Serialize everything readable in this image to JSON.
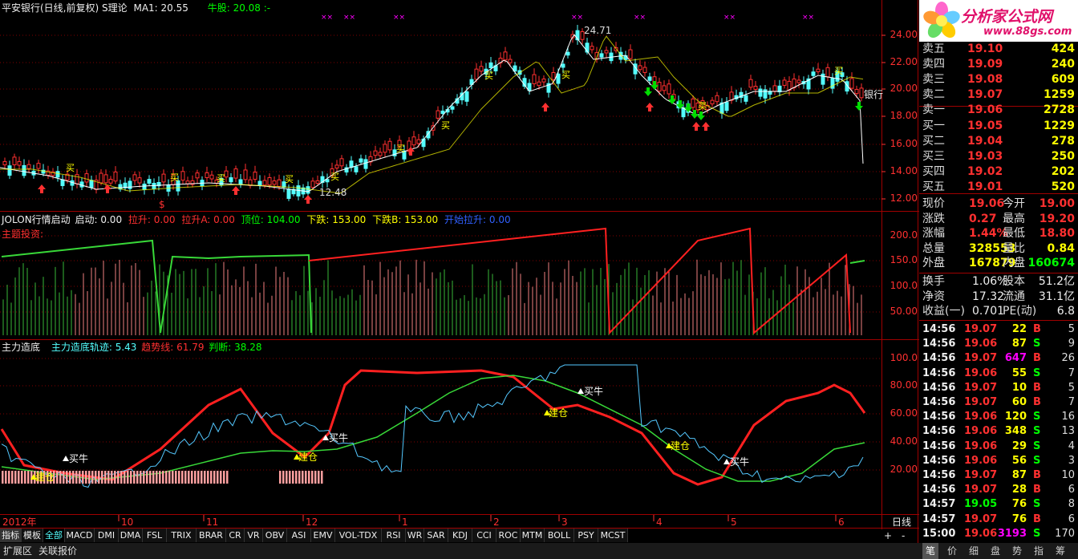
{
  "header": {
    "stock": "平安银行(日线,前复权)",
    "theory": "S理论",
    "ma": "MA1: 20.55",
    "bull": "牛股: 20.08",
    "dash": ":-"
  },
  "price_axis": [
    "24.00",
    "22.00",
    "20.00",
    "18.00",
    "16.00",
    "14.00",
    "12.00"
  ],
  "annotations": {
    "high": "24.71",
    "low": "12.48",
    "bank": "银行",
    "buy_small": "买",
    "dollar": "$"
  },
  "mid_panel": {
    "title": "JOLON行情启动",
    "qidong": "启动: 0.00",
    "lasheng": "拉升: 0.00",
    "lashengA": "拉升A: 0.00",
    "dingwei": "顶位: 104.00",
    "xiadie": "下跌: 153.00",
    "xiadieB": "下跌B: 153.00",
    "kaishi": "开始拉升: 0.00",
    "theme": "主题投资:",
    "axis": [
      "200.0",
      "150.0",
      "100.0",
      "50.00"
    ]
  },
  "bottom_panel": {
    "title": "主力造底",
    "guiji": "主力造底轨迹: 5.43",
    "qushi": "趋势线: 61.79",
    "panduan": "判断: 38.28",
    "axis": [
      "100.0",
      "80.00",
      "60.00",
      "40.00",
      "20.00"
    ],
    "jiancang": "建仓",
    "mainiu": "买牛"
  },
  "date_axis": {
    "year": "2012年",
    "months": [
      "10",
      "11",
      "12",
      "1",
      "2",
      "3",
      "4",
      "5",
      "6"
    ],
    "period": "日线"
  },
  "logo": {
    "name": "分析家公式网",
    "url": "www.88gs.com"
  },
  "order_book": {
    "asks": [
      {
        "label": "卖五",
        "price": "19.10",
        "vol": "424"
      },
      {
        "label": "卖四",
        "price": "19.09",
        "vol": "240"
      },
      {
        "label": "卖三",
        "price": "19.08",
        "vol": "609"
      },
      {
        "label": "卖二",
        "price": "19.07",
        "vol": "1259"
      },
      {
        "label": "卖一",
        "price": "19.06",
        "vol": "2728"
      }
    ],
    "bids": [
      {
        "label": "买一",
        "price": "19.05",
        "vol": "1229"
      },
      {
        "label": "买二",
        "price": "19.04",
        "vol": "278"
      },
      {
        "label": "买三",
        "price": "19.03",
        "vol": "250"
      },
      {
        "label": "买四",
        "price": "19.02",
        "vol": "202"
      },
      {
        "label": "买五",
        "price": "19.01",
        "vol": "520"
      }
    ]
  },
  "quote": [
    {
      "l1": "现价",
      "v1": "19.06",
      "l2": "今开",
      "v2": "19.00"
    },
    {
      "l1": "涨跌",
      "v1": "0.27",
      "l2": "最高",
      "v2": "19.20"
    },
    {
      "l1": "涨幅",
      "v1": "1.44%",
      "l2": "最低",
      "v2": "18.80"
    },
    {
      "l1": "总量",
      "v1": "328553",
      "l2": "量比",
      "v2": "0.84"
    },
    {
      "l1": "外盘",
      "v1": "167879",
      "l2": "内盘",
      "v2": "160674"
    }
  ],
  "fundamentals": [
    {
      "l1": "换手",
      "v1": "1.06%",
      "l2": "股本",
      "v2": "51.2亿"
    },
    {
      "l1": "净资",
      "v1": "17.32",
      "l2": "流通",
      "v2": "31.1亿"
    },
    {
      "l1": "收益(一)",
      "v1": "0.701",
      "l2": "PE(动)",
      "v2": "6.8"
    }
  ],
  "ticks": [
    {
      "t": "14:56",
      "p": "19.07",
      "v": "22",
      "s": "B",
      "n": "5"
    },
    {
      "t": "14:56",
      "p": "19.06",
      "v": "87",
      "s": "S",
      "n": "9"
    },
    {
      "t": "14:56",
      "p": "19.07",
      "v": "647",
      "s": "B",
      "n": "26"
    },
    {
      "t": "14:56",
      "p": "19.06",
      "v": "55",
      "s": "S",
      "n": "7"
    },
    {
      "t": "14:56",
      "p": "19.07",
      "v": "10",
      "s": "B",
      "n": "5"
    },
    {
      "t": "14:56",
      "p": "19.07",
      "v": "60",
      "s": "B",
      "n": "7"
    },
    {
      "t": "14:56",
      "p": "19.06",
      "v": "120",
      "s": "S",
      "n": "16"
    },
    {
      "t": "14:56",
      "p": "19.06",
      "v": "348",
      "s": "S",
      "n": "13"
    },
    {
      "t": "14:56",
      "p": "19.06",
      "v": "29",
      "s": "S",
      "n": "4"
    },
    {
      "t": "14:56",
      "p": "19.06",
      "v": "56",
      "s": "S",
      "n": "3"
    },
    {
      "t": "14:56",
      "p": "19.07",
      "v": "87",
      "s": "B",
      "n": "10"
    },
    {
      "t": "14:56",
      "p": "19.07",
      "v": "28",
      "s": "B",
      "n": "6"
    },
    {
      "t": "14:57",
      "p": "19.05",
      "v": "76",
      "s": "S",
      "n": "8"
    },
    {
      "t": "14:57",
      "p": "19.07",
      "v": "76",
      "s": "B",
      "n": "6"
    },
    {
      "t": "15:00",
      "p": "19.06",
      "v": "3193",
      "s": "S",
      "n": "170"
    }
  ],
  "tabs": [
    "指标",
    "模板",
    "全部",
    "MACD",
    "DMI",
    "DMA",
    "FSL",
    "TRIX",
    "BRAR",
    "CR",
    "VR",
    "OBV",
    "ASI",
    "EMV",
    "VOL-TDX",
    "RSI",
    "WR",
    "SAR",
    "KDJ",
    "CCI",
    "ROC",
    "MTM",
    "BOLL",
    "PSY",
    "MCST"
  ],
  "bottom_tabs": [
    "扩展区",
    "关联报价"
  ],
  "right_tabs": [
    "笔",
    "价",
    "细",
    "盘",
    "势",
    "指",
    "筹"
  ],
  "colors": {
    "up": "#ff3030",
    "down": "#54ffff",
    "yellow": "#ffff00",
    "green": "#00ff00",
    "magenta": "#ff00ff",
    "grid": "#800000"
  }
}
